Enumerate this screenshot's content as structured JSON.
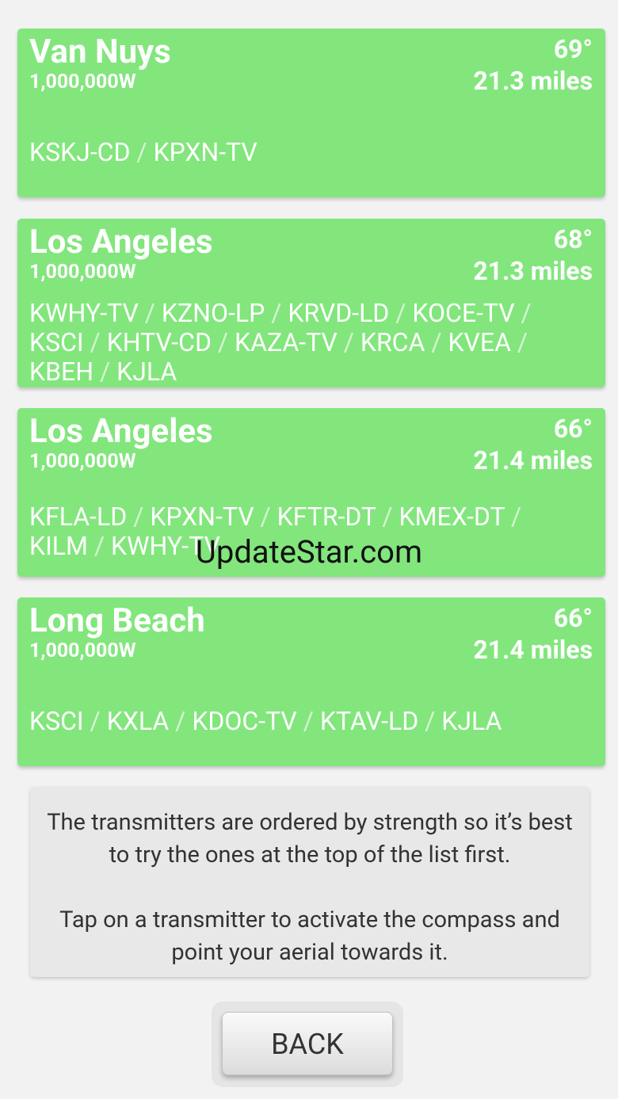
{
  "transmitters": [
    {
      "city": "Van Nuys",
      "power": "1,000,000W",
      "bearing": "69°",
      "distance": "21.3 miles",
      "stations": [
        "KSKJ-CD",
        "KPXN-TV"
      ]
    },
    {
      "city": "Los Angeles",
      "power": "1,000,000W",
      "bearing": "68°",
      "distance": "21.3 miles",
      "stations": [
        "KWHY-TV",
        "KZNO-LP",
        "KRVD-LD",
        "KOCE-TV",
        "KSCI",
        "KHTV-CD",
        "KAZA-TV",
        "KRCA",
        "KVEA",
        "KBEH",
        "KJLA"
      ]
    },
    {
      "city": "Los Angeles",
      "power": "1,000,000W",
      "bearing": "66°",
      "distance": "21.4 miles",
      "stations": [
        "KFLA-LD",
        "KPXN-TV",
        "KFTR-DT",
        "KMEX-DT",
        "KILM",
        "KWHY-TV"
      ]
    },
    {
      "city": "Long Beach",
      "power": "1,000,000W",
      "bearing": "66°",
      "distance": "21.4 miles",
      "stations": [
        "KSCI",
        "KXLA",
        "KDOC-TV",
        "KTAV-LD",
        "KJLA"
      ]
    }
  ],
  "separator": "/",
  "info": {
    "paragraph1": "The transmitters are ordered by strength so it’s best to try the ones at the top of the list first.",
    "paragraph2": "Tap on a transmitter to activate the compass and point your aerial towards it."
  },
  "back_label": "BACK",
  "watermark": "UpdateStar.com",
  "colors": {
    "card": "#82e67d",
    "background": "#f2f2f2",
    "info_box": "#e8e8e8"
  }
}
